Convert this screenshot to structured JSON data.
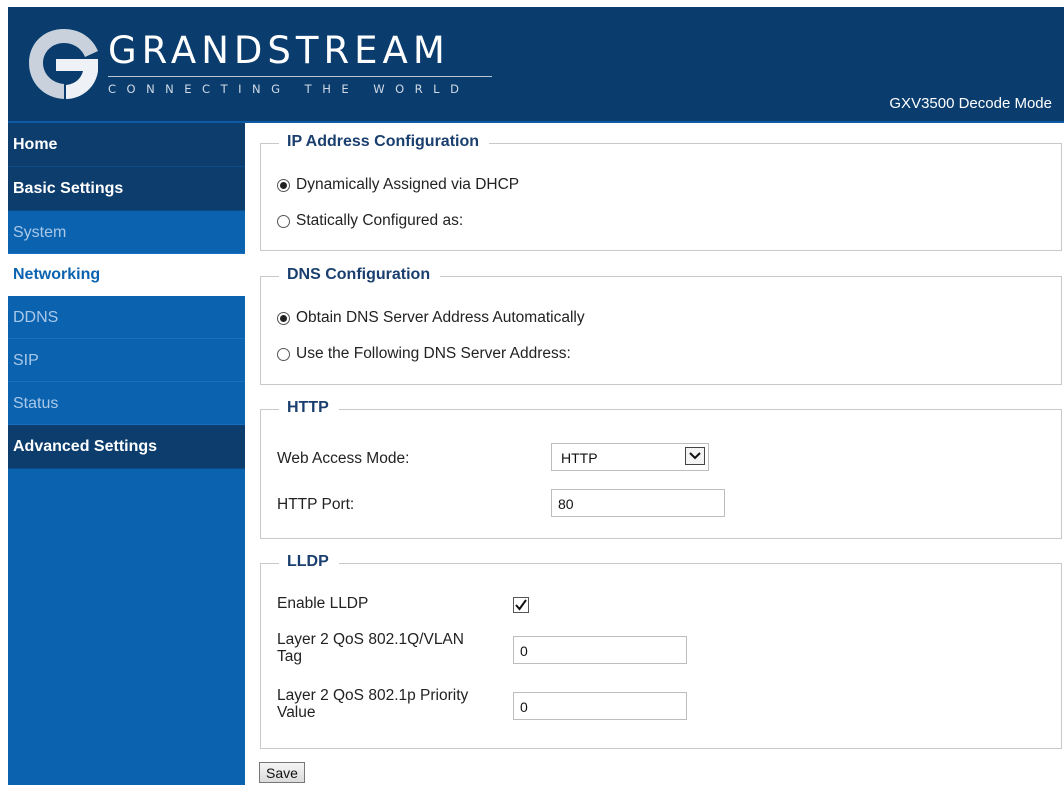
{
  "header": {
    "brand_name": "GRANDSTREAM",
    "tagline": "CONNECTING THE WORLD",
    "model_label": "GXV3500 Decode Mode"
  },
  "sidebar": {
    "items": [
      {
        "label": "Home"
      },
      {
        "label": "Basic Settings"
      },
      {
        "label": "System"
      },
      {
        "label": "Networking"
      },
      {
        "label": "DDNS"
      },
      {
        "label": "SIP"
      },
      {
        "label": "Status"
      },
      {
        "label": "Advanced Settings"
      }
    ]
  },
  "ip_config": {
    "legend": "IP Address Configuration",
    "options": [
      {
        "label": "Dynamically Assigned via DHCP",
        "selected": true
      },
      {
        "label": "Statically Configured as:",
        "selected": false
      }
    ]
  },
  "dns_config": {
    "legend": "DNS Configuration",
    "options": [
      {
        "label": "Obtain DNS Server Address Automatically",
        "selected": true
      },
      {
        "label": "Use the Following DNS Server Address:",
        "selected": false
      }
    ]
  },
  "http": {
    "legend": "HTTP",
    "web_access_label": "Web Access Mode:",
    "web_access_value": "HTTP",
    "port_label": "HTTP Port:",
    "port_value": "80"
  },
  "lldp": {
    "legend": "LLDP",
    "enable_label": "Enable LLDP",
    "enable_checked": true,
    "vlan_label_line1": "Layer 2 QoS 802.1Q/VLAN",
    "vlan_label_line2": "Tag",
    "vlan_value": "0",
    "priority_label_line1": "Layer 2 QoS 802.1p Priority",
    "priority_label_line2": "Value",
    "priority_value": "0"
  },
  "actions": {
    "save_label": "Save"
  },
  "colors": {
    "header_bg": "#0a3d6e",
    "sidebar_bg": "#0b63b0",
    "sidebar_head_bg": "#0c3d6d",
    "legend_text": "#1a3f6f"
  }
}
